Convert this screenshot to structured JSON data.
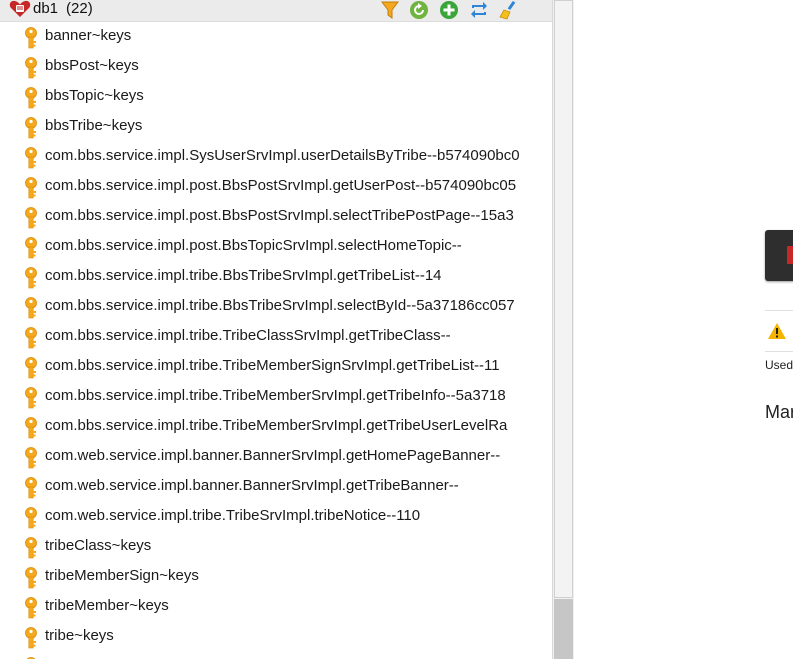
{
  "db": {
    "name": "db1",
    "count": "(22)"
  },
  "toolbar": {
    "buttons": [
      "filter-icon",
      "reload-icon",
      "add-icon",
      "rename-icon",
      "broom-icon"
    ]
  },
  "keys": [
    "banner~keys",
    "bbsPost~keys",
    "bbsTopic~keys",
    "bbsTribe~keys",
    "com.bbs.service.impl.SysUserSrvImpl.userDetailsByTribe--b574090bc0",
    "com.bbs.service.impl.post.BbsPostSrvImpl.getUserPost--b574090bc05",
    "com.bbs.service.impl.post.BbsPostSrvImpl.selectTribePostPage--15a3",
    "com.bbs.service.impl.post.BbsTopicSrvImpl.selectHomeTopic--",
    "com.bbs.service.impl.tribe.BbsTribeSrvImpl.getTribeList--14",
    "com.bbs.service.impl.tribe.BbsTribeSrvImpl.selectById--5a37186cc057",
    "com.bbs.service.impl.tribe.TribeClassSrvImpl.getTribeClass--",
    "com.bbs.service.impl.tribe.TribeMemberSignSrvImpl.getTribeList--11",
    "com.bbs.service.impl.tribe.TribeMemberSrvImpl.getTribeInfo--5a3718",
    "com.bbs.service.impl.tribe.TribeMemberSrvImpl.getTribeUserLevelRa",
    "com.web.service.impl.banner.BannerSrvImpl.getHomePageBanner--",
    "com.web.service.impl.banner.BannerSrvImpl.getTribeBanner--",
    "com.web.service.impl.tribe.TribeSrvImpl.tribeNotice--110",
    "tribeClass~keys",
    "tribeMemberSign~keys",
    "tribeMember~keys",
    "tribe~keys",
    ""
  ],
  "right_panel": {
    "used_label": "Used",
    "manage_label": "Mar"
  },
  "colors": {
    "key_icon": "#f4a81d",
    "reload": "#6fb43f",
    "add": "#3aa63a",
    "rename": "#2f86d6",
    "db_icon": "#c62828",
    "warning": "#f5b400"
  }
}
